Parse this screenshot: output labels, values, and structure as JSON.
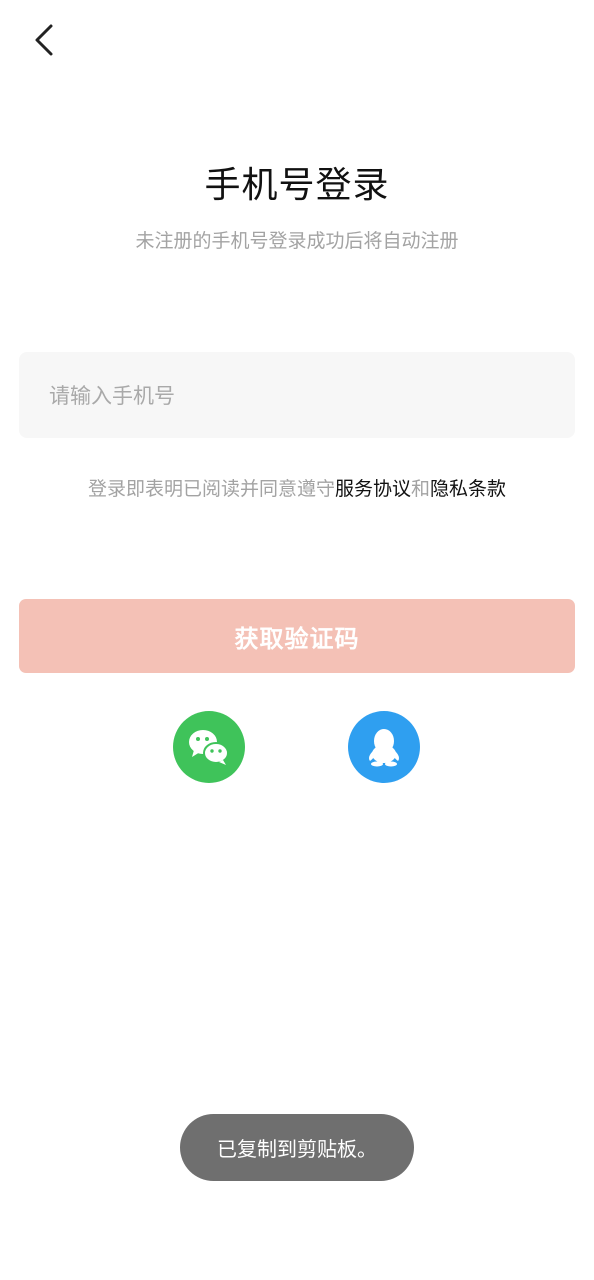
{
  "header": {
    "back_icon": "chevron-left-icon"
  },
  "login": {
    "title": "手机号登录",
    "subtitle": "未注册的手机号登录成功后将自动注册",
    "phone_input": {
      "value": "",
      "placeholder": "请输入手机号"
    },
    "agreement": {
      "prefix": "登录即表明已阅读并同意遵守",
      "service_link": "服务协议",
      "conjunction": "和",
      "privacy_link": "隐私条款"
    },
    "get_code_button": "获取验证码"
  },
  "social_login": [
    {
      "name": "wechat",
      "icon": "wechat-icon",
      "color": "#3fc35a"
    },
    {
      "name": "qq",
      "icon": "qq-icon",
      "color": "#2f9ff0"
    }
  ],
  "toast": {
    "message": "已复制到剪贴板。"
  },
  "colors": {
    "button_disabled": "#f4c1b6",
    "link": "#111111",
    "muted_text": "#a3a3a3"
  }
}
